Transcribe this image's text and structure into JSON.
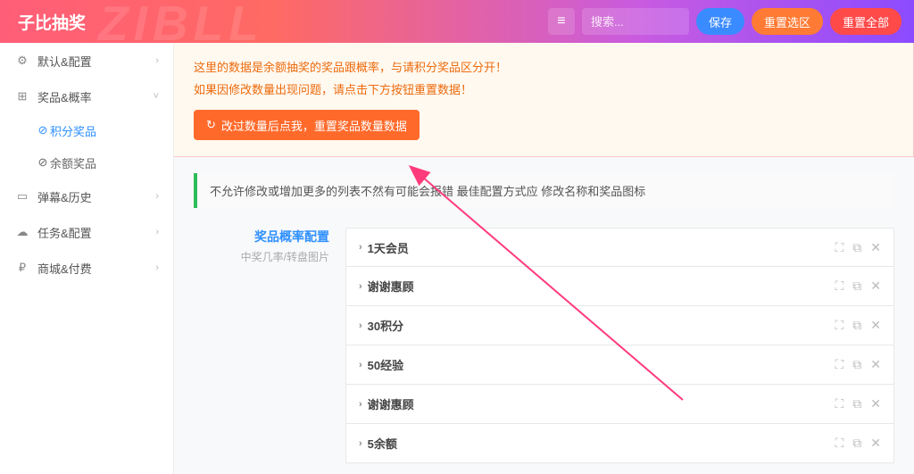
{
  "header": {
    "title": "子比抽奖",
    "watermark": "ZIBLL",
    "search_placeholder": "搜索...",
    "save_label": "保存",
    "reset_sel_label": "重置选区",
    "reset_all_label": "重置全部"
  },
  "sidebar": {
    "items": [
      {
        "icon": "gear",
        "label": "默认&配置",
        "chev": "›"
      },
      {
        "icon": "pkg",
        "label": "奖品&概率",
        "chev": "˅",
        "expanded": true,
        "children": [
          {
            "label": "积分奖品",
            "active": true
          },
          {
            "label": "余额奖品",
            "active": false
          }
        ]
      },
      {
        "icon": "book",
        "label": "弹幕&历史",
        "chev": "›"
      },
      {
        "icon": "cloud",
        "label": "任务&配置",
        "chev": "›"
      },
      {
        "icon": "ruble",
        "label": "商城&付费",
        "chev": "›"
      }
    ]
  },
  "warn": {
    "line1": "这里的数据是余额抽奖的奖品跟概率，与请积分奖品区分开！",
    "line2": "如果因修改数量出现问题，请点击下方按钮重置数据！",
    "button": "改过数量后点我，重置奖品数量数据"
  },
  "tip": "不允许修改或增加更多的列表不然有可能会报错 最佳配置方式应  修改名称和奖品图标",
  "config": {
    "title": "奖品概率配置",
    "subtitle": "中奖几率/转盘图片"
  },
  "prizes": [
    {
      "name": "1天会员"
    },
    {
      "name": "谢谢惠顾"
    },
    {
      "name": "30积分"
    },
    {
      "name": "50经验"
    },
    {
      "name": "谢谢惠顾"
    },
    {
      "name": "5余额"
    }
  ],
  "icons": {
    "gear": "⚙",
    "pkg": "⊞",
    "book": "▭",
    "cloud": "☁",
    "ruble": "₽",
    "list": "≡",
    "circle": "⊘",
    "refresh": "↻",
    "expand": "⛶",
    "copy": "⧉",
    "close": "✕"
  }
}
